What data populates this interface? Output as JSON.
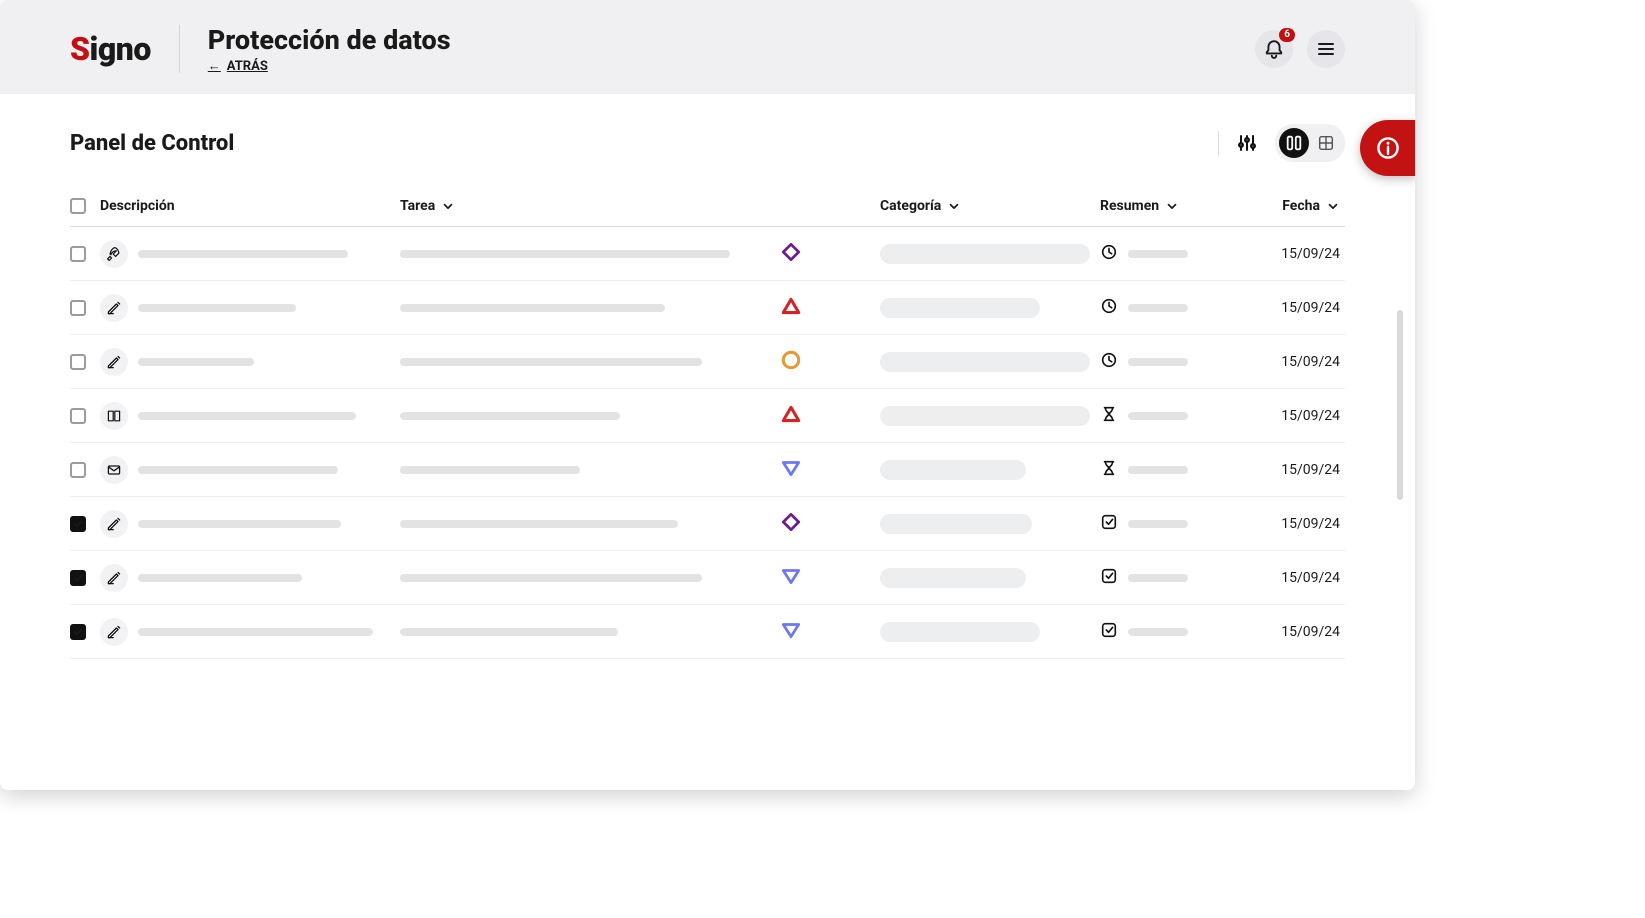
{
  "brand": {
    "left": "S",
    "right": "igno"
  },
  "header": {
    "title": "Protección de datos",
    "back_label": "ATRÁS"
  },
  "notifications": {
    "count": "6"
  },
  "panel": {
    "title": "Panel de Control"
  },
  "columns": {
    "descripcion": "Descripción",
    "tarea": "Tarea",
    "categoria": "Categoría",
    "resumen": "Resumen",
    "fecha": "Fecha"
  },
  "rows": [
    {
      "checked": false,
      "type_icon": "rocket",
      "desc_w": 210,
      "tarea_w": 330,
      "prio": "diamond-purple",
      "cat_w": 210,
      "status": "clock",
      "res_w": 60,
      "fecha": "15/09/24"
    },
    {
      "checked": false,
      "type_icon": "pen",
      "desc_w": 158,
      "tarea_w": 265,
      "prio": "triangle-red",
      "cat_w": 160,
      "status": "clock",
      "res_w": 60,
      "fecha": "15/09/24"
    },
    {
      "checked": false,
      "type_icon": "pen",
      "desc_w": 116,
      "tarea_w": 302,
      "prio": "circle-orange",
      "cat_w": 210,
      "status": "clock",
      "res_w": 60,
      "fecha": "15/09/24"
    },
    {
      "checked": false,
      "type_icon": "book",
      "desc_w": 218,
      "tarea_w": 220,
      "prio": "triangle-red",
      "cat_w": 210,
      "status": "hourglass",
      "res_w": 60,
      "fecha": "15/09/24"
    },
    {
      "checked": false,
      "type_icon": "mail",
      "desc_w": 200,
      "tarea_w": 180,
      "prio": "tri-down-blue",
      "cat_w": 146,
      "status": "hourglass",
      "res_w": 60,
      "fecha": "15/09/24"
    },
    {
      "checked": true,
      "type_icon": "pen",
      "desc_w": 203,
      "tarea_w": 278,
      "prio": "diamond-purple",
      "cat_w": 152,
      "status": "check",
      "res_w": 60,
      "fecha": "15/09/24"
    },
    {
      "checked": true,
      "type_icon": "pen",
      "desc_w": 164,
      "tarea_w": 302,
      "prio": "tri-down-blue",
      "cat_w": 146,
      "status": "check",
      "res_w": 60,
      "fecha": "15/09/24"
    },
    {
      "checked": true,
      "type_icon": "pen",
      "desc_w": 235,
      "tarea_w": 218,
      "prio": "tri-down-blue",
      "cat_w": 160,
      "status": "check",
      "res_w": 60,
      "fecha": "15/09/24"
    }
  ]
}
